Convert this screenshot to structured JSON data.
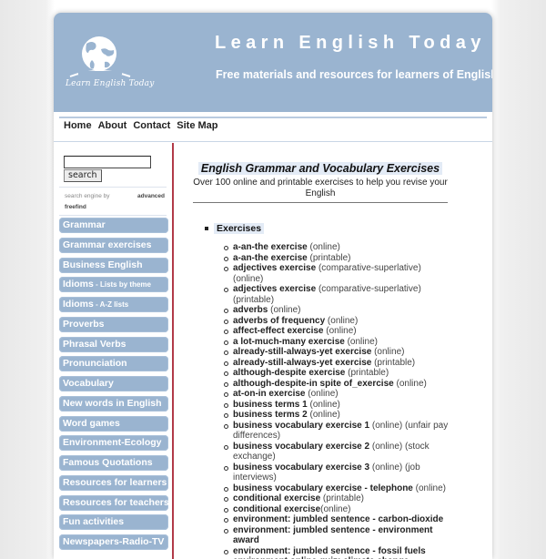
{
  "header": {
    "title": "Learn English Today",
    "tagline": "Free materials and resources for learners of English.",
    "logo_text": "Learn English Today",
    "logo_icon": "globe-icon"
  },
  "colors": {
    "header_bg": "#9ab4d0",
    "sidebar_item_bg": "#9ab4d0",
    "divider": "#b23a48",
    "highlight": "#e3ebf6"
  },
  "nav": {
    "items": [
      "Home",
      "About",
      "Contact",
      "Site Map"
    ]
  },
  "search": {
    "input_value": "",
    "button_label": "search",
    "credit_prefix": "search engine by",
    "credit_link": "freefind",
    "advanced_link": "advanced"
  },
  "sidebar": {
    "items": [
      {
        "label": "Grammar",
        "sub": ""
      },
      {
        "label": "Grammar exercises",
        "sub": ""
      },
      {
        "label": "Business English",
        "sub": ""
      },
      {
        "label": "Idioms",
        "sub": " - Lists by theme"
      },
      {
        "label": "Idioms",
        "sub": " - A-Z lists"
      },
      {
        "label": "Proverbs",
        "sub": ""
      },
      {
        "label": "Phrasal Verbs",
        "sub": ""
      },
      {
        "label": "Pronunciation",
        "sub": ""
      },
      {
        "label": "Vocabulary",
        "sub": ""
      },
      {
        "label": "New words in English",
        "sub": ""
      },
      {
        "label": "Word games",
        "sub": ""
      },
      {
        "label": "Environment-Ecology",
        "sub": ""
      },
      {
        "label": "Famous Quotations",
        "sub": ""
      },
      {
        "label": "Resources for learners",
        "sub": ""
      },
      {
        "label": "Resources for teachers",
        "sub": ""
      },
      {
        "label": "Fun activities",
        "sub": ""
      },
      {
        "label": "Newspapers-Radio-TV",
        "sub": ""
      }
    ]
  },
  "content": {
    "title": "English Grammar and Vocabulary Exercises",
    "subtitle": "Over 100 online and printable exercises to help you revise your English",
    "section_label": "Exercises",
    "exercises": [
      {
        "name": "a-an-the exercise",
        "note": " (online)"
      },
      {
        "name": "a-an-the exercise",
        "note": " (printable)"
      },
      {
        "name": "adjectives exercise",
        "note": " (comparative-superlative)(online)"
      },
      {
        "name": "adjectives exercise",
        "note": " (comparative-superlative) (printable)"
      },
      {
        "name": "adverbs",
        "note": " (online)"
      },
      {
        "name": "adverbs of frequency",
        "note": " (online)"
      },
      {
        "name": "affect-effect exercise",
        "note": " (online)"
      },
      {
        "name": "a lot-much-many exercise",
        "note": " (online)"
      },
      {
        "name": "already-still-always-yet exercise",
        "note": " (online)"
      },
      {
        "name": "already-still-always-yet exercise",
        "note": " (printable)"
      },
      {
        "name": "although-despite exercise",
        "note": " (printable)"
      },
      {
        "name": "although-despite-in spite of_exercise",
        "note": " (online)"
      },
      {
        "name": "at-on-in exercise",
        "note": " (online)"
      },
      {
        "name": "business terms 1",
        "note": " (online)"
      },
      {
        "name": "business terms 2",
        "note": " (online)"
      },
      {
        "name": "business vocabulary exercise 1",
        "note": " (online) (unfair pay differences)"
      },
      {
        "name": "business vocabulary exercise 2",
        "note": " (online) (stock exchange)"
      },
      {
        "name": "business vocabulary exercise 3",
        "note": " (online) (job interviews)"
      },
      {
        "name": "business vocabulary exercise - telephone",
        "note": " (online)"
      },
      {
        "name": "conditional exercise",
        "note": " (printable)"
      },
      {
        "name": "conditional exercise",
        "note": "(online)"
      },
      {
        "name": "environment: jumbled sentence - carbon-dioxide",
        "note": ""
      },
      {
        "name": "environment: jumbled sentence - environment award",
        "note": ""
      },
      {
        "name": "environment: jumbled sentence - fossil fuels",
        "note": ""
      },
      {
        "name": "environment online quiz: climate change",
        "note": ""
      }
    ]
  }
}
